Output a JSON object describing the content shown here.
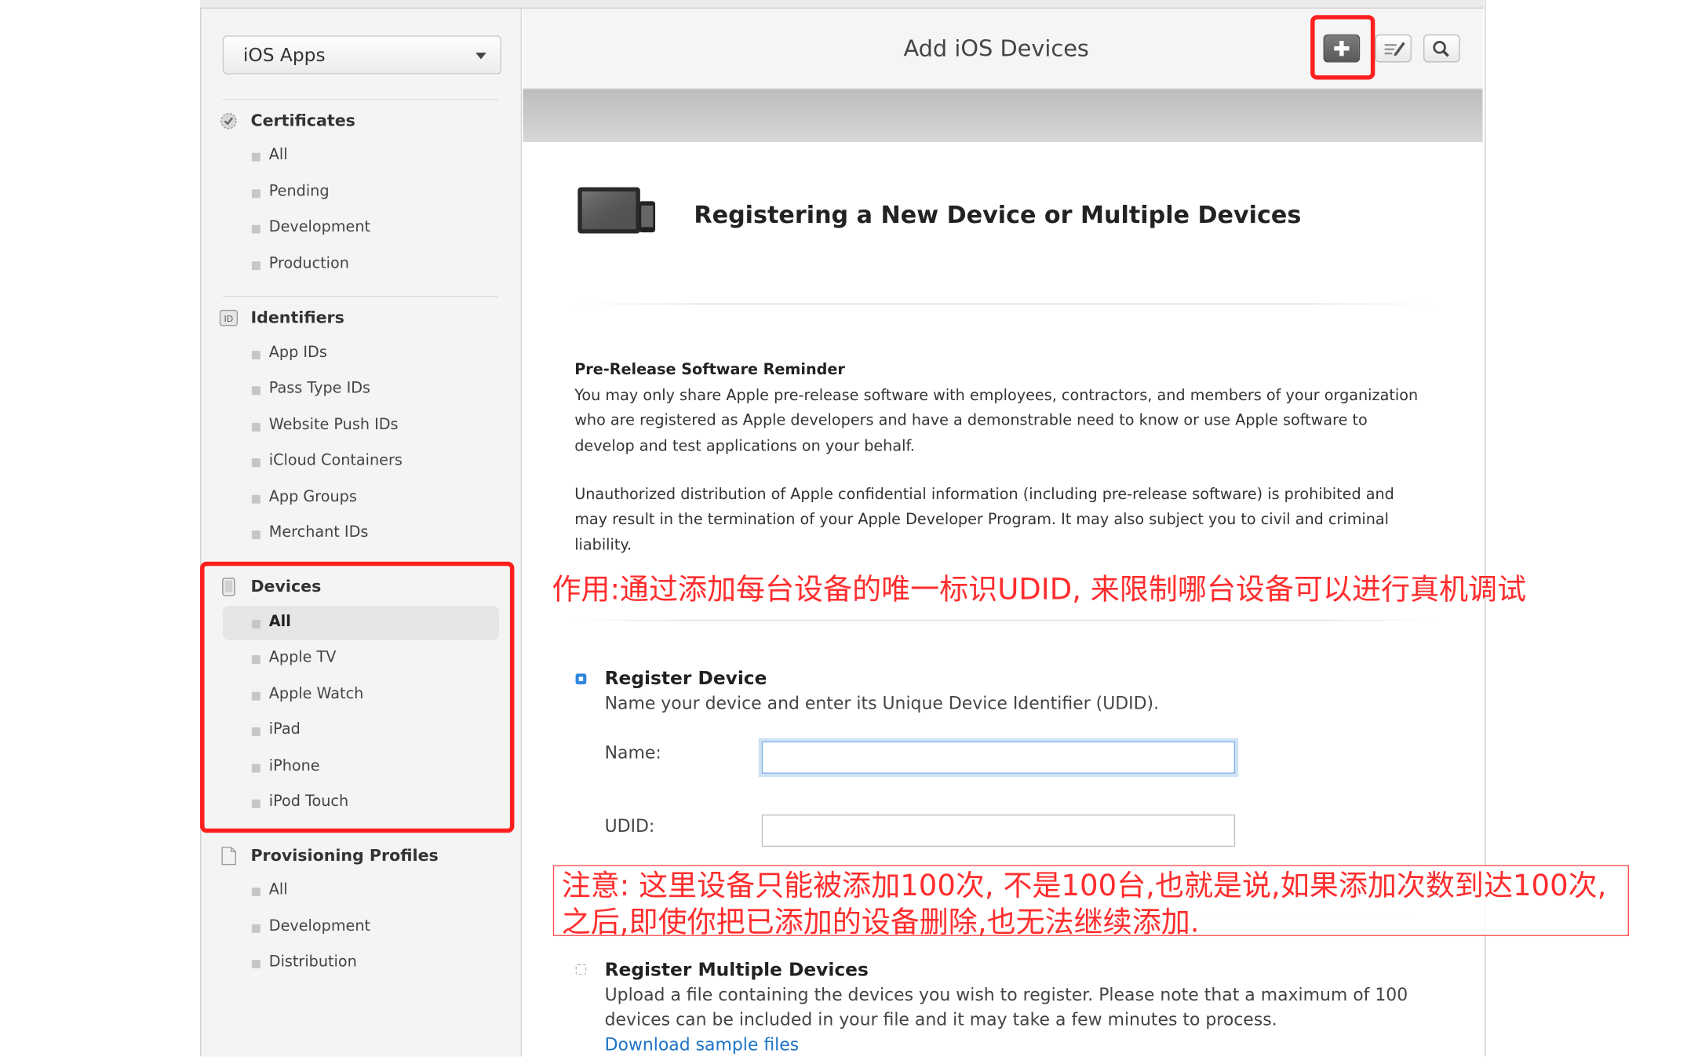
{
  "sidebar": {
    "platform_label": "iOS Apps",
    "sections": [
      {
        "title": "Certificates",
        "icon": "certificate-icon",
        "items": [
          "All",
          "Pending",
          "Development",
          "Production"
        ]
      },
      {
        "title": "Identifiers",
        "icon": "id-badge-icon",
        "items": [
          "App IDs",
          "Pass Type IDs",
          "Website Push IDs",
          "iCloud Containers",
          "App Groups",
          "Merchant IDs"
        ]
      },
      {
        "title": "Devices",
        "icon": "device-icon",
        "items": [
          "All",
          "Apple TV",
          "Apple Watch",
          "iPad",
          "iPhone",
          "iPod Touch"
        ],
        "active_item": "All"
      },
      {
        "title": "Provisioning Profiles",
        "icon": "document-icon",
        "items": [
          "All",
          "Development",
          "Distribution"
        ]
      }
    ]
  },
  "header": {
    "title": "Add iOS Devices",
    "buttons": [
      "add-icon",
      "edit-icon",
      "search-icon"
    ]
  },
  "main": {
    "title": "Registering a New Device or Multiple Devices",
    "reminder_title": "Pre-Release Software Reminder",
    "reminder_text": "You may only share Apple pre-release software with employees, contractors, and members of your organization who are registered as Apple developers and have a demonstrable need to know or use Apple software to develop and test applications on your behalf.",
    "unauthorized_text": "Unauthorized distribution of Apple confidential information (including pre-release software) is prohibited and may result in the termination of your Apple Developer Program. It may also subject you to civil and criminal liability.",
    "register_device": {
      "title": "Register Device",
      "description": "Name your device and enter its Unique Device Identifier (UDID).",
      "name_label": "Name:",
      "name_value": "",
      "udid_label": "UDID:",
      "udid_value": ""
    },
    "register_multiple": {
      "title": "Register Multiple Devices",
      "description": "Upload a file containing the devices you wish to register. Please note that a maximum of 100 devices can be included in your file and it may take a few minutes to process.",
      "link": "Download sample files"
    }
  },
  "annotations": {
    "note1": "作用:通过添加每台设备的唯一标识UDID, 来限制哪台设备可以进行真机调试",
    "note2": "注意: 这里设备只能被添加100次, 不是100台,也就是说,如果添加次数到达100次,之后,即使你把已添加的设备删除,也无法继续添加.",
    "highlight_color": "#ff1f1f"
  }
}
